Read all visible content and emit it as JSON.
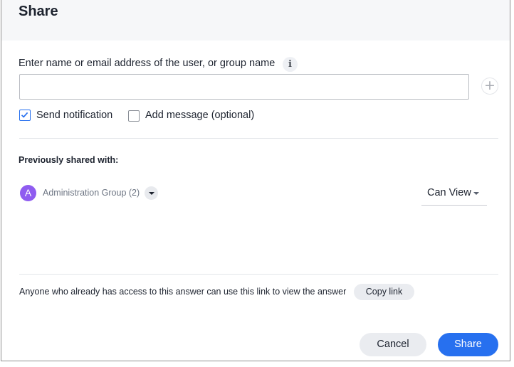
{
  "dialog": {
    "title": "Share"
  },
  "recipient": {
    "label": "Enter name or email address of the user, or group name",
    "info_icon": "i",
    "input_value": "",
    "input_placeholder": "",
    "add_icon": "+"
  },
  "options": {
    "send_notification": {
      "label": "Send notification",
      "checked": true
    },
    "add_message": {
      "label": "Add message (optional)",
      "checked": false
    }
  },
  "shared_with": {
    "heading": "Previously shared with:",
    "entries": [
      {
        "avatar_letter": "A",
        "name": "Administration Group (2)",
        "permission": "Can View"
      }
    ]
  },
  "link_section": {
    "description": "Anyone who already has access to this answer can use this link to view the answer",
    "copy_label": "Copy link"
  },
  "footer": {
    "cancel_label": "Cancel",
    "share_label": "Share"
  },
  "colors": {
    "accent": "#2770ef",
    "avatar": "#8f5cf0",
    "header_bg": "#f6f7f9"
  }
}
